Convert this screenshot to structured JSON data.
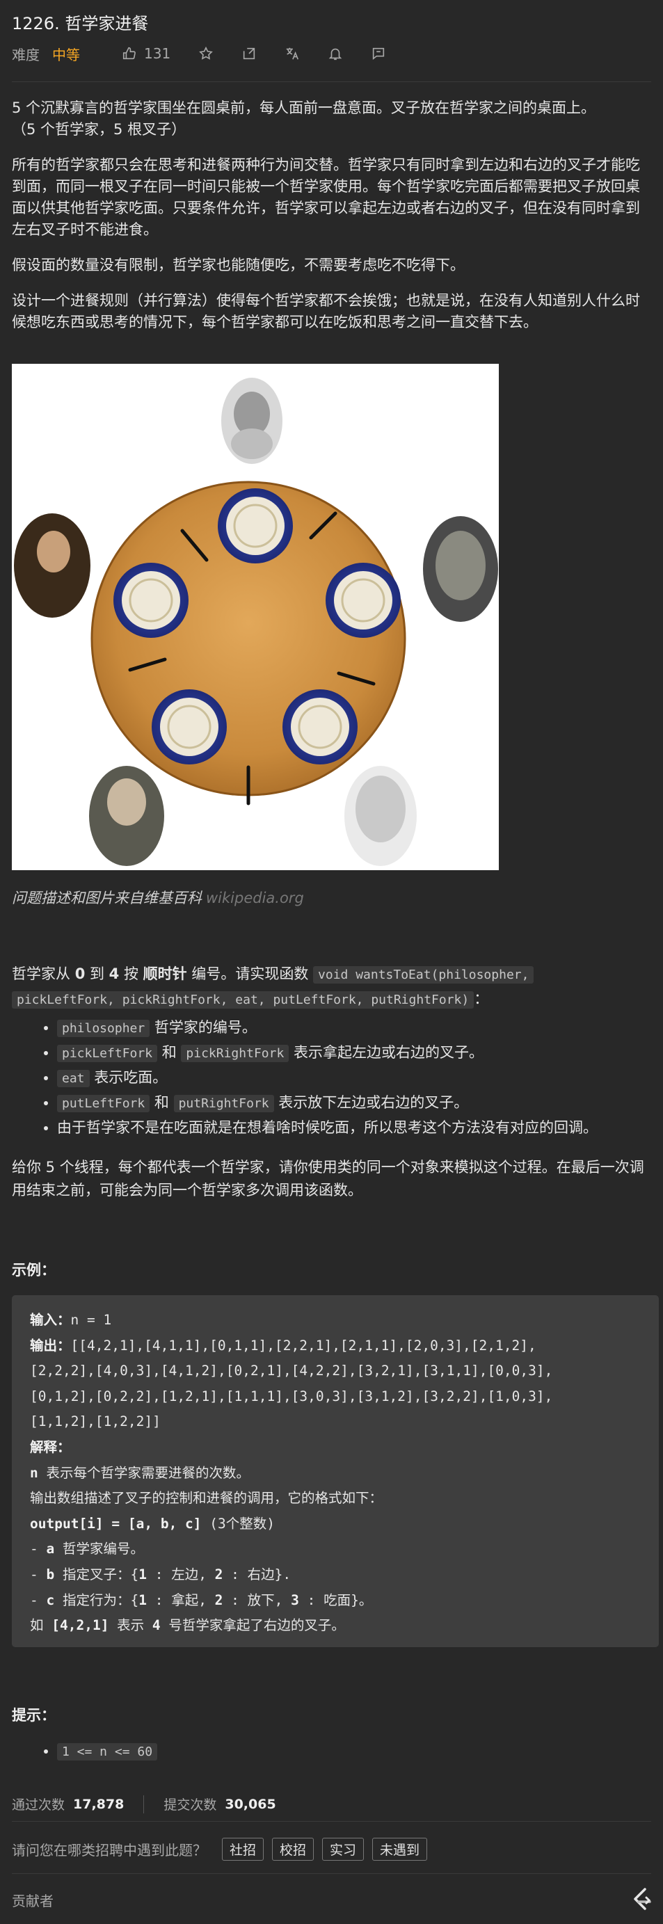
{
  "header": {
    "title": "1226. 哲学家进餐",
    "difficulty_label": "难度",
    "difficulty_value": "中等",
    "likes": "131",
    "icons": [
      "thumbs-up-icon",
      "star-icon",
      "share-icon",
      "translate-icon",
      "bell-icon",
      "comment-icon"
    ]
  },
  "description": {
    "p1_line1": "5 个沉默寡言的哲学家围坐在圆桌前，每人面前一盘意面。叉子放在哲学家之间的桌面上。",
    "p1_line2": "（5 个哲学家，5 根叉子）",
    "p2": "所有的哲学家都只会在思考和进餐两种行为间交替。哲学家只有同时拿到左边和右边的叉子才能吃到面，而同一根叉子在同一时间只能被一个哲学家使用。每个哲学家吃完面后都需要把叉子放回桌面以供其他哲学家吃面。只要条件允许，哲学家可以拿起左边或者右边的叉子，但在没有同时拿到左右叉子时不能进食。",
    "p3": "假设面的数量没有限制，哲学家也能随便吃，不需要考虑吃不吃得下。",
    "p4": "设计一个进餐规则（并行算法）使得每个哲学家都不会挨饿；也就是说，在没有人知道别人什么时候想吃东西或思考的情况下，每个哲学家都可以在吃饭和思考之间一直交替下去。"
  },
  "caption": {
    "text": "问题描述和图片来自维基百科",
    "link": "wikipedia.org"
  },
  "impl": {
    "pre": "哲学家从 ",
    "zero": "0",
    "to": " 到 ",
    "four": "4",
    "by": " 按 ",
    "clockwise": "顺时针",
    "post": " 编号。请实现函数 ",
    "code1": "void wantsToEat(philosopher,",
    "code2": "pickLeftFork, pickRightFork, eat, putLeftFork, putRightFork)",
    "colon": "："
  },
  "bullets": {
    "b1_code": "philosopher",
    "b1_text": " 哲学家的编号。",
    "b2_code1": "pickLeftFork",
    "b2_and": " 和 ",
    "b2_code2": "pickRightFork",
    "b2_text": " 表示拿起左边或右边的叉子。",
    "b3_code": "eat",
    "b3_text": " 表示吃面。",
    "b4_code1": "putLeftFork",
    "b4_and": " 和 ",
    "b4_code2": "putRightFork",
    "b4_text": " 表示放下左边或右边的叉子。",
    "b5_text": "由于哲学家不是在吃面就是在想着啥时候吃面，所以思考这个方法没有对应的回调。"
  },
  "threads_para": "给你 5 个线程，每个都代表一个哲学家，请你使用类的同一个对象来模拟这个过程。在最后一次调用结束之前，可能会为同一个哲学家多次调用该函数。",
  "example": {
    "heading": "示例：",
    "input_label": "输入：",
    "input_value": "n = 1",
    "output_label": "输出：",
    "output_l1": "[[4,2,1],[4,1,1],[0,1,1],[2,2,1],[2,1,1],[2,0,3],[2,1,2],",
    "output_l2": "[2,2,2],[4,0,3],[4,1,2],[0,2,1],[4,2,2],[3,2,1],[3,1,1],[0,0,3],",
    "output_l3": "[0,1,2],[0,2,2],[1,2,1],[1,1,1],[3,0,3],[3,1,2],[3,2,2],[1,0,3],",
    "output_l4": "[1,1,2],[1,2,2]]",
    "explain_label": "解释：",
    "e1_bold": "n",
    "e1": " 表示每个哲学家需要进餐的次数。",
    "e2": "输出数组描述了叉子的控制和进餐的调用，它的格式如下：",
    "e3_bold": "output[i] = [a, b, c]",
    "e3": " (3个整数)",
    "e4_pre": "- ",
    "e4_bold": "a",
    "e4": " 哲学家编号。",
    "e5_pre": "- ",
    "e5_bold": "b",
    "e5": " 指定叉子：{",
    "e5_b1": "1",
    "e5_m": " : 左边, ",
    "e5_b2": "2",
    "e5_e": " : 右边}.",
    "e6_pre": "- ",
    "e6_bold": "c",
    "e6": " 指定行为：{",
    "e6_b1": "1",
    "e6_m1": " : 拿起, ",
    "e6_b2": "2",
    "e6_m2": " : 放下, ",
    "e6_b3": "3",
    "e6_e": " : 吃面}。",
    "e7_pre": "如 ",
    "e7_bold": "[4,2,1]",
    "e7_m": " 表示 ",
    "e7_b2": "4",
    "e7": " 号哲学家拿起了右边的叉子。"
  },
  "hints": {
    "heading": "提示：",
    "h1": "1 <= n <= 60"
  },
  "stats": {
    "accepted_label": "通过次数",
    "accepted_value": "17,878",
    "submitted_label": "提交次数",
    "submitted_value": "30,065"
  },
  "survey": {
    "question": "请问您在哪类招聘中遇到此题？",
    "options": [
      "社招",
      "校招",
      "实习",
      "未遇到"
    ]
  },
  "footer": {
    "contributors": "贡献者"
  }
}
